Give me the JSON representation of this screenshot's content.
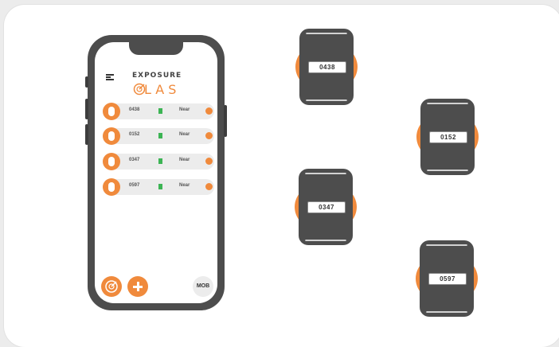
{
  "app": {
    "logo_top": "EXPOSURE",
    "logo_bottom": "LAS"
  },
  "devices": [
    {
      "id": "0438",
      "status": "Near"
    },
    {
      "id": "0152",
      "status": "Near"
    },
    {
      "id": "0347",
      "status": "Near"
    },
    {
      "id": "0597",
      "status": "Near"
    }
  ],
  "buttons": {
    "mob_label": "MOB"
  },
  "tags": [
    {
      "label": "0438"
    },
    {
      "label": "0152"
    },
    {
      "label": "0347"
    },
    {
      "label": "0597"
    }
  ],
  "colors": {
    "accent": "#f08a3c",
    "device_body": "#4d4d4d",
    "signal": "#3cb454"
  },
  "icons": {
    "menu": "hamburger-menu-icon",
    "radar": "radar-icon",
    "add": "plus-icon",
    "device": "wearable-tag-icon"
  }
}
